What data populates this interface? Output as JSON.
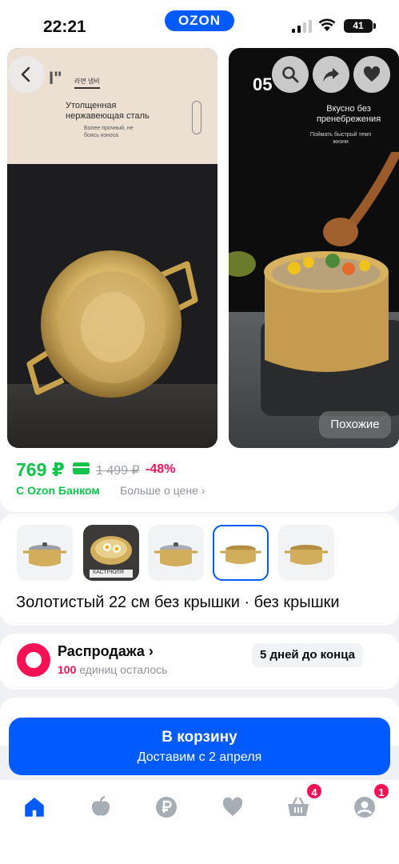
{
  "status_bar": {
    "time": "22:21",
    "center_logo": "OZON",
    "battery": "41"
  },
  "gallery": {
    "photo_1": {
      "brand_mark": "Ӏ\"",
      "korean_label": "라면 냄비",
      "caption_title": "Утолщенная нержавеющая сталь",
      "caption_sub": "Более прочный, не боясь износа"
    },
    "photo_2": {
      "number": "05",
      "caption_title": "Вкусно без пренебрежения",
      "caption_sub": "Поймать быстрый темп жизни"
    },
    "similar_label": "Похожие"
  },
  "price": {
    "current": "769 ₽",
    "old": "1 499 ₽",
    "discount": "-48%",
    "bank_label": "С Ozon Банком",
    "more_label": "Больше о цене ›"
  },
  "variants": {
    "thumb_photo_text": "КАСТРЮЛЯ",
    "selected_name": "Золотистый 22 см без крышки · без крышки"
  },
  "sale": {
    "title": "Распродажа ›",
    "count_value": "100",
    "count_text": " единиц осталось",
    "days_left": "5 дней до конца"
  },
  "cart": {
    "title": "В корзину",
    "subtitle": "Доставим с 2 апреля"
  },
  "tab_bar": {
    "cart_badge": "4",
    "profile_badge": "1"
  },
  "colors": {
    "brand_blue": "#005bff",
    "price_green": "#10c44c",
    "sale_pink": "#f91155"
  }
}
